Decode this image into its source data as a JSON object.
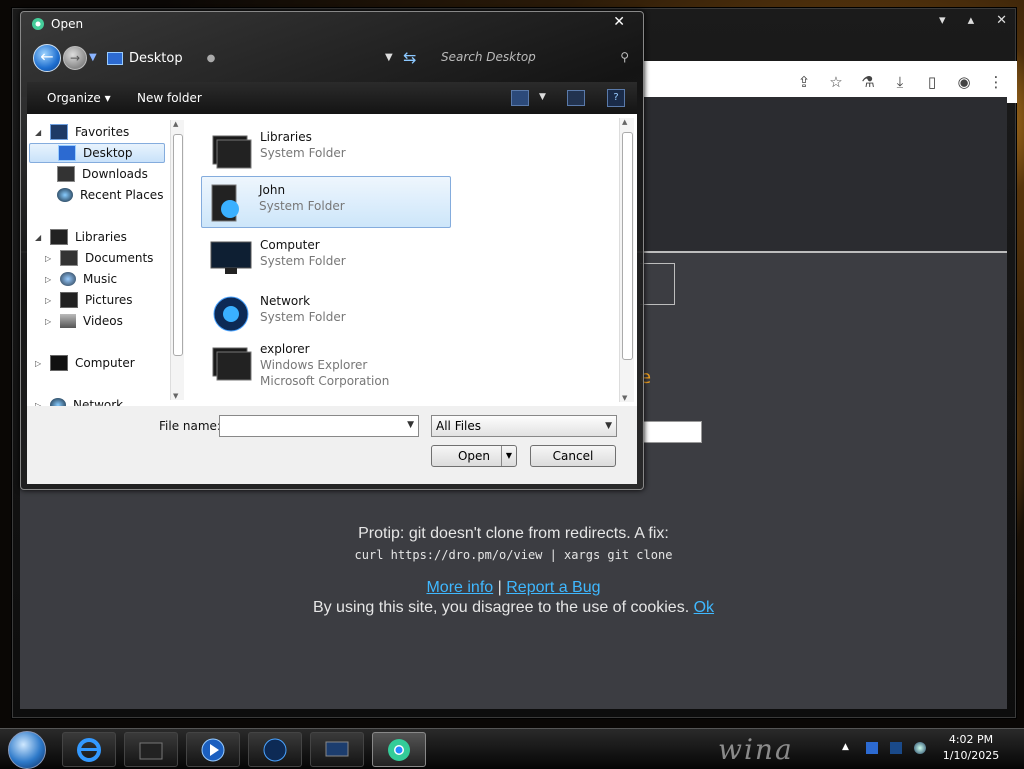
{
  "dialog": {
    "title": "Open",
    "close_glyph": "✕",
    "address": "Desktop",
    "search_placeholder": "Search Desktop",
    "toolbar": {
      "organize": "Organize ▾",
      "new_folder": "New folder"
    },
    "nav_tree": {
      "favorites": {
        "label": "Favorites",
        "items": [
          "Desktop",
          "Downloads",
          "Recent Places"
        ]
      },
      "libraries": {
        "label": "Libraries",
        "items": [
          "Documents",
          "Music",
          "Pictures",
          "Videos"
        ]
      },
      "computer": "Computer",
      "network": "Network"
    },
    "files": [
      {
        "name": "Libraries",
        "type": "System Folder",
        "icon": "libraries-icon"
      },
      {
        "name": "John",
        "type": "System Folder",
        "icon": "user-folder-icon",
        "selected": true
      },
      {
        "name": "Computer",
        "type": "System Folder",
        "icon": "computer-icon"
      },
      {
        "name": "Network",
        "type": "System Folder",
        "icon": "network-icon"
      },
      {
        "name": "explorer",
        "type": "Windows Explorer",
        "company": "Microsoft Corporation",
        "icon": "explorer-icon"
      }
    ],
    "file_name_label": "File name:",
    "file_name_value": "",
    "filter": "All Files",
    "open_button": "Open",
    "cancel_button": "Cancel"
  },
  "page": {
    "protip": "Protip: git doesn't clone from redirects. A fix:",
    "command": "curl https://dro.pm/o/view | xargs git clone",
    "more_info": "More info",
    "separator": "|",
    "report_bug": "Report a Bug",
    "cookie_text": "By using this site, you disagree to the use of cookies.",
    "cookie_ok": "Ok",
    "orange_glyph": "e"
  },
  "taskbar": {
    "time": "4:02 PM",
    "date": "1/10/2025",
    "watermark": "wina"
  },
  "colors": {
    "page_bg": "#3c3d42",
    "link": "#3fb8ff",
    "selection": "#cde6fa"
  }
}
